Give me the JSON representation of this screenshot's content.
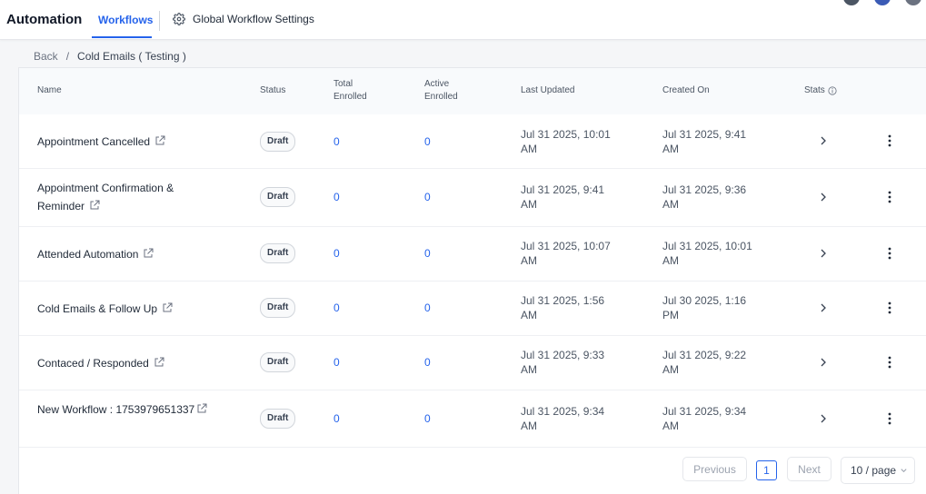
{
  "header": {
    "app_title": "Automation",
    "tabs": [
      {
        "label": "Workflows",
        "active": true
      }
    ],
    "settings_label": "Global Workflow Settings",
    "accent_color": "#2563eb"
  },
  "breadcrumb": {
    "back": "Back",
    "separator": "/",
    "current": "Cold Emails ( Testing )"
  },
  "table": {
    "columns": {
      "name": "Name",
      "status": "Status",
      "total_enrolled_1": "Total",
      "total_enrolled_2": "Enrolled",
      "active_enrolled_1": "Active",
      "active_enrolled_2": "Enrolled",
      "last_updated": "Last Updated",
      "created_on": "Created On",
      "stats": "Stats"
    },
    "rows": [
      {
        "name": "Appointment Cancelled",
        "status": "Draft",
        "total": "0",
        "active": "0",
        "updated_1": "Jul 31 2025, 10:01",
        "updated_2": "AM",
        "created_1": "Jul 31 2025, 9:41",
        "created_2": "AM"
      },
      {
        "name": "Appointment Confirmation & Reminder",
        "status": "Draft",
        "total": "0",
        "active": "0",
        "updated_1": "Jul 31 2025, 9:41",
        "updated_2": "AM",
        "created_1": "Jul 31 2025, 9:36",
        "created_2": "AM"
      },
      {
        "name": "Attended Automation",
        "status": "Draft",
        "total": "0",
        "active": "0",
        "updated_1": "Jul 31 2025, 10:07",
        "updated_2": "AM",
        "created_1": "Jul 31 2025, 10:01",
        "created_2": "AM"
      },
      {
        "name": "Cold Emails & Follow Up",
        "status": "Draft",
        "total": "0",
        "active": "0",
        "updated_1": "Jul 31 2025, 1:56",
        "updated_2": "AM",
        "created_1": "Jul 30 2025, 1:16",
        "created_2": "PM"
      },
      {
        "name": "Contaced / Responded",
        "status": "Draft",
        "total": "0",
        "active": "0",
        "updated_1": "Jul 31 2025, 9:33",
        "updated_2": "AM",
        "created_1": "Jul 31 2025, 9:22",
        "created_2": "AM"
      },
      {
        "name": "New Workflow : 1753979651337",
        "status": "Draft",
        "total": "0",
        "active": "0",
        "updated_1": "Jul 31 2025, 9:34",
        "updated_2": "AM",
        "created_1": "Jul 31 2025, 9:34",
        "created_2": "AM"
      }
    ]
  },
  "pagination": {
    "previous": "Previous",
    "current_page": "1",
    "next": "Next",
    "page_size": "10 / page"
  }
}
